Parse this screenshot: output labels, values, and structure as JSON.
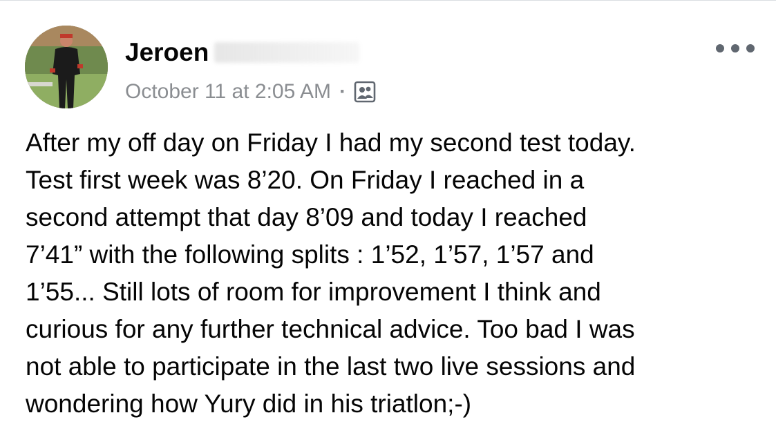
{
  "post": {
    "author": {
      "name": "Jeroen"
    },
    "timestamp": "October 11 at 2:05 AM",
    "separator": "·",
    "audience_icon": "friends-icon",
    "more_icon": "more-options-icon",
    "text_lines": [
      "After my off day on Friday I had my second test today.",
      "Test first week was 8’20. On Friday I reached in a",
      "second attempt that day 8’09 and today I reached",
      "7’41” with the following splits : 1’52, 1’57, 1’57 and",
      "1’55... Still lots of room for improvement I think and",
      "curious for any further technical advice. Too bad I was",
      "not able to participate in the last two live sessions and",
      "wondering how Yury did in his triatlon;-)"
    ]
  },
  "colors": {
    "text_primary": "#050505",
    "text_secondary": "#8a8d91",
    "icon_gray": "#606770",
    "border": "#dadde1"
  }
}
